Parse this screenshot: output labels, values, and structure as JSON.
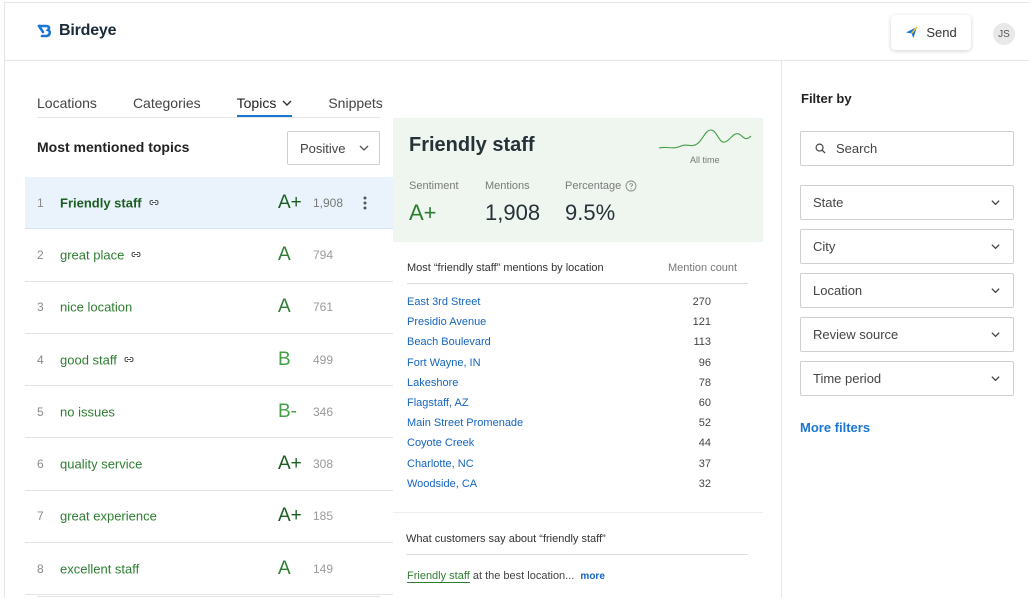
{
  "app": {
    "logo": "Birdeye",
    "send_label": "Send",
    "avatar_initials": "JS"
  },
  "tabs": [
    {
      "label": "Locations"
    },
    {
      "label": "Categories"
    },
    {
      "label": "Topics"
    },
    {
      "label": "Snippets"
    }
  ],
  "list": {
    "title": "Most mentioned topics",
    "filter_value": "Positive",
    "rows": [
      {
        "num": "1",
        "name": "Friendly staff",
        "grade": "A+",
        "count": "1,908",
        "linked": true,
        "selected": true,
        "grade_color": "#1b5e20"
      },
      {
        "num": "2",
        "name": "great place",
        "grade": "A",
        "count": "794",
        "linked": true,
        "selected": false,
        "grade_color": "#2e7d32"
      },
      {
        "num": "3",
        "name": "nice location",
        "grade": "A",
        "count": "761",
        "linked": false,
        "selected": false,
        "grade_color": "#2e7d32"
      },
      {
        "num": "4",
        "name": "good staff",
        "grade": "B",
        "count": "499",
        "linked": true,
        "selected": false,
        "grade_color": "#43a047"
      },
      {
        "num": "5",
        "name": "no issues",
        "grade": "B-",
        "count": "346",
        "linked": false,
        "selected": false,
        "grade_color": "#43a047"
      },
      {
        "num": "6",
        "name": "quality service",
        "grade": "A+",
        "count": "308",
        "linked": false,
        "selected": false,
        "grade_color": "#1b5e20"
      },
      {
        "num": "7",
        "name": "great experience",
        "grade": "A+",
        "count": "185",
        "linked": false,
        "selected": false,
        "grade_color": "#1b5e20"
      },
      {
        "num": "8",
        "name": "excellent staff",
        "grade": "A",
        "count": "149",
        "linked": false,
        "selected": false,
        "grade_color": "#2e7d32"
      }
    ]
  },
  "detail": {
    "title": "Friendly staff",
    "trend_label": "All time",
    "sentiment_label": "Sentiment",
    "sentiment_value": "A+",
    "mentions_label": "Mentions",
    "mentions_value": "1,908",
    "percentage_label": "Percentage",
    "percentage_value": "9.5%",
    "locations_heading": "Most “friendly staff” mentions by location",
    "count_heading": "Mention count",
    "locations": [
      {
        "name": "East 3rd Street",
        "count": "270"
      },
      {
        "name": "Presidio Avenue",
        "count": "121"
      },
      {
        "name": "Beach Boulevard",
        "count": "113"
      },
      {
        "name": "Fort Wayne, IN",
        "count": "96"
      },
      {
        "name": "Lakeshore",
        "count": "78"
      },
      {
        "name": "Flagstaff, AZ",
        "count": "60"
      },
      {
        "name": "Main Street Promenade",
        "count": "52"
      },
      {
        "name": "Coyote Creek",
        "count": "44"
      },
      {
        "name": "Charlotte, NC",
        "count": "37"
      },
      {
        "name": "Woodside, CA",
        "count": "32"
      }
    ],
    "say_heading": "What customers say about “friendly staff”",
    "snippet_highlight": "Friendly staff",
    "snippet_rest": " at the best location...",
    "snippet_more": "more"
  },
  "filters": {
    "title": "Filter by",
    "search_placeholder": "Search",
    "selects": [
      {
        "label": "State"
      },
      {
        "label": "City"
      },
      {
        "label": "Location"
      },
      {
        "label": "Review source"
      },
      {
        "label": "Time period"
      }
    ],
    "more_label": "More filters"
  },
  "colors": {
    "accent": "#1976d2",
    "positive": "#2e7d32",
    "selected_row": "#eaf3fb",
    "detail_bg": "#eef6ef"
  }
}
